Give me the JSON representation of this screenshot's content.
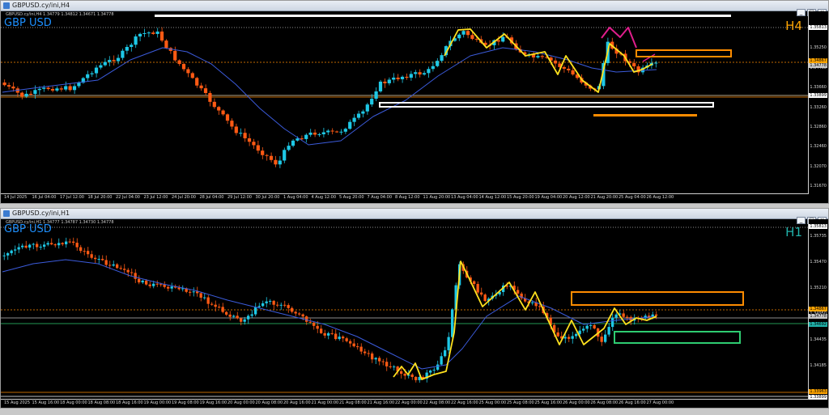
{
  "windows": {
    "h4": {
      "title": "GBPUSD.cy/ini,H4",
      "symbol": "GBP USD",
      "timeframe": "H4",
      "timeframe_color": "#ffa500",
      "ohlc": "GBPUSD.cy/ini,H4 1.34779 1.34812 1.34671 1.34778",
      "price_labels": [
        "1.36050",
        "1.35250",
        "1.34460",
        "1.33660",
        "1.33260",
        "1.32860",
        "1.32460",
        "1.32070",
        "1.31670"
      ],
      "price_tags": [
        {
          "text": "1.35813",
          "bg": "#ffffff"
        },
        {
          "text": "1.34867",
          "bg": "#ffa500"
        },
        {
          "text": "1.34778",
          "bg": "#c8c8c8"
        },
        {
          "text": "1.33899",
          "bg": "#ffffff"
        }
      ],
      "time_labels": [
        "14 Jul 2025",
        "16 Jul 04:00",
        "17 Jul 12:00",
        "18 Jul 20:00",
        "22 Jul 04:00",
        "23 Jul 12:00",
        "24 Jul 20:00",
        "28 Jul 04:00",
        "29 Jul 12:00",
        "30 Jul 20:00",
        "1 Aug 04:00",
        "4 Aug 12:00",
        "5 Aug 20:00",
        "7 Aug 04:00",
        "8 Aug 12:00",
        "11 Aug 20:00",
        "13 Aug 04:00",
        "14 Aug 12:00",
        "15 Aug 20:00",
        "19 Aug 04:00",
        "20 Aug 12:00",
        "21 Aug 20:00",
        "25 Aug 04:00",
        "26 Aug 12:00"
      ]
    },
    "h1": {
      "title": "GBPUSD.cy/ini,H1",
      "symbol": "GBP USD",
      "timeframe": "H1",
      "timeframe_color": "#20b2aa",
      "ohlc": "GBPUSD.cy/ini,H1 1.34777 1.34787 1.34730 1.34778",
      "price_labels": [
        "1.35735",
        "1.35470",
        "1.35210",
        "1.34950",
        "1.34435",
        "1.34185",
        "1.33920"
      ],
      "price_tags": [
        {
          "text": "1.35813",
          "bg": "#ffffff"
        },
        {
          "text": "1.34867",
          "bg": "#ffa500"
        },
        {
          "text": "1.34778",
          "bg": "#c8c8c8"
        },
        {
          "text": "1.34692",
          "bg": "#20b2aa"
        },
        {
          "text": "1.33963",
          "bg": "#ffa500"
        },
        {
          "text": "1.33899",
          "bg": "#ffffff"
        }
      ],
      "time_labels": [
        "15 Aug 2025",
        "15 Aug 16:00",
        "18 Aug 00:00",
        "18 Aug 08:00",
        "18 Aug 16:00",
        "19 Aug 00:00",
        "19 Aug 08:00",
        "19 Aug 16:00",
        "20 Aug 00:00",
        "20 Aug 08:00",
        "20 Aug 16:00",
        "21 Aug 00:00",
        "21 Aug 08:00",
        "21 Aug 16:00",
        "22 Aug 00:00",
        "22 Aug 08:00",
        "22 Aug 16:00",
        "25 Aug 00:00",
        "25 Aug 08:00",
        "25 Aug 16:00",
        "26 Aug 00:00",
        "26 Aug 08:00",
        "26 Aug 16:00",
        "27 Aug 00:00"
      ]
    }
  },
  "window_controls": {
    "minimize": "_",
    "maximize": "□",
    "close": "×"
  },
  "colors": {
    "bull": "#1ec8e6",
    "bear": "#ff5a14",
    "ma": "#3b5bdb",
    "zigzag": "#ffe11e",
    "box_orange": "#ff8c00",
    "box_green": "#2ecc71",
    "pink": "#e01e8c"
  },
  "icons": [
    "app-icon",
    "minimize-icon",
    "maximize-icon",
    "close-icon"
  ]
}
